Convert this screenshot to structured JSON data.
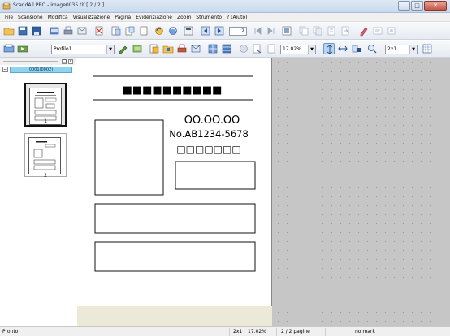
{
  "window": {
    "title": "ScandAll PRO -            image0035.tif  [ 2 / 2 ]",
    "minimize": "—",
    "maximize": "□",
    "close": "✕"
  },
  "menu": [
    "File",
    "Scansione",
    "Modifica",
    "Visualizzazione",
    "Pagina",
    "Evidenziazione",
    "Zoom",
    "Strumento",
    "? (Aiuto)"
  ],
  "toolbar": {
    "page_number": "2",
    "profile": "Profilo1",
    "zoom": "17.02%",
    "view_mode": "2x1"
  },
  "thumbnails": {
    "batch_label": "0001(0002)",
    "expand": "−",
    "pages": [
      {
        "label": "1"
      },
      {
        "label": "2"
      }
    ],
    "pane_minimize": "□",
    "pane_close": "x"
  },
  "document": {
    "header_blocks": "■■■■■■■■■■",
    "date_text": "OO.OO.OO",
    "number_text": "No.AB1234-5678",
    "code_boxes": "□□□□□□□"
  },
  "status": {
    "state": "Pronto",
    "mode": "2x1",
    "zoom": "17.02%",
    "pages": "2 / 2 pagine",
    "mark": "no mark"
  },
  "colors": {
    "batch_highlight": "#8fd4ef",
    "view_background": "#c6c6c6"
  }
}
